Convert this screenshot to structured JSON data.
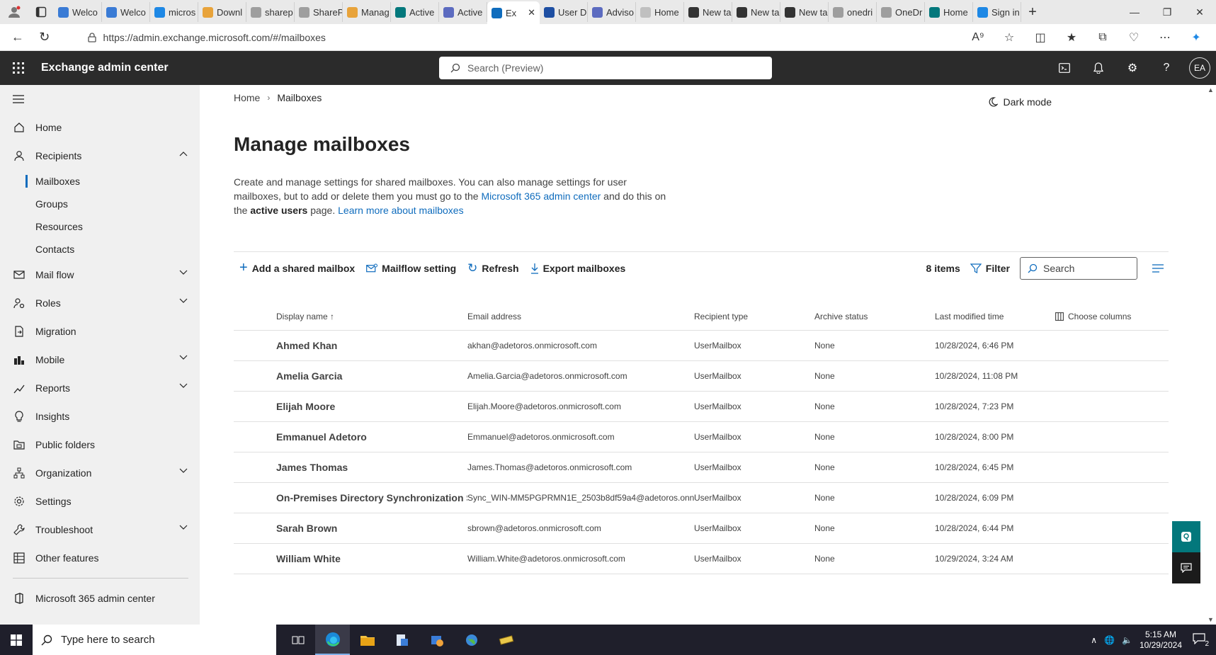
{
  "browser": {
    "tabs": [
      {
        "label": "Welco",
        "color": "#3a7bd5"
      },
      {
        "label": "Welco",
        "color": "#3a7bd5"
      },
      {
        "label": "micros",
        "color": "#1e88e5"
      },
      {
        "label": "Downl",
        "color": "#e8a33a"
      },
      {
        "label": "sharep",
        "color": "#9e9e9e"
      },
      {
        "label": "ShareP",
        "color": "#9e9e9e"
      },
      {
        "label": "Manag",
        "color": "#e8a33a"
      },
      {
        "label": "Active",
        "color": "#03787c"
      },
      {
        "label": "Active",
        "color": "#5c6bc0"
      },
      {
        "label": "Ex",
        "color": "#0f6cbd",
        "active": true
      },
      {
        "label": "User D",
        "color": "#1e4fa3"
      },
      {
        "label": "Adviso",
        "color": "#5c6bc0"
      },
      {
        "label": "Home",
        "color": "#c0c0c0"
      },
      {
        "label": "New ta",
        "color": "#333333"
      },
      {
        "label": "New ta",
        "color": "#333333"
      },
      {
        "label": "New ta",
        "color": "#333333"
      },
      {
        "label": "onedri",
        "color": "#9e9e9e"
      },
      {
        "label": "OneDr",
        "color": "#9e9e9e"
      },
      {
        "label": "Home",
        "color": "#03787c"
      },
      {
        "label": "Sign in",
        "color": "#1e88e5"
      }
    ],
    "url": "https://admin.exchange.microsoft.com/#/mailboxes"
  },
  "header": {
    "app_name": "Exchange admin center",
    "search_placeholder": "Search (Preview)",
    "avatar_initials": "EA"
  },
  "sidebar": {
    "items": [
      {
        "label": "Home",
        "icon": "home-icon",
        "expandable": false
      },
      {
        "label": "Recipients",
        "icon": "person-icon",
        "expandable": true,
        "expanded": true,
        "children": [
          {
            "label": "Mailboxes",
            "selected": true
          },
          {
            "label": "Groups"
          },
          {
            "label": "Resources"
          },
          {
            "label": "Contacts"
          }
        ]
      },
      {
        "label": "Mail flow",
        "icon": "mail-icon",
        "expandable": true
      },
      {
        "label": "Roles",
        "icon": "roles-icon",
        "expandable": true
      },
      {
        "label": "Migration",
        "icon": "migration-icon",
        "expandable": false
      },
      {
        "label": "Mobile",
        "icon": "mobile-icon",
        "expandable": true
      },
      {
        "label": "Reports",
        "icon": "reports-icon",
        "expandable": true
      },
      {
        "label": "Insights",
        "icon": "lightbulb-icon",
        "expandable": false
      },
      {
        "label": "Public folders",
        "icon": "folder-icon",
        "expandable": false
      },
      {
        "label": "Organization",
        "icon": "organization-icon",
        "expandable": true
      },
      {
        "label": "Settings",
        "icon": "gear-icon",
        "expandable": false
      },
      {
        "label": "Troubleshoot",
        "icon": "wrench-icon",
        "expandable": true
      },
      {
        "label": "Other features",
        "icon": "grid-icon",
        "expandable": false
      }
    ],
    "footer_link": "Microsoft 365 admin center"
  },
  "main": {
    "breadcrumb": [
      "Home",
      "Mailboxes"
    ],
    "dark_mode_label": "Dark mode",
    "title": "Manage mailboxes",
    "description": {
      "part1": "Create and manage settings for shared mailboxes. You can also manage settings for user mailboxes, but to add or delete them you must go to the ",
      "link1": "Microsoft 365 admin center",
      "part2": " and do this on the ",
      "bold": "active users",
      "part3": " page. ",
      "link2": "Learn more about mailboxes"
    },
    "commands": {
      "add": "Add a shared mailbox",
      "mailflow": "Mailflow setting",
      "refresh": "Refresh",
      "export": "Export mailboxes"
    },
    "item_count": "8 items",
    "filter_label": "Filter",
    "search_placeholder": "Search",
    "columns": {
      "display_name": "Display name",
      "email": "Email address",
      "recipient_type": "Recipient type",
      "archive_status": "Archive status",
      "last_modified": "Last modified time",
      "choose_columns": "Choose columns"
    },
    "rows": [
      {
        "name": "Ahmed Khan",
        "email": "akhan@adetoros.onmicrosoft.com",
        "type": "UserMailbox",
        "archive": "None",
        "modified": "10/28/2024, 6:46 PM"
      },
      {
        "name": "Amelia Garcia",
        "email": "Amelia.Garcia@adetoros.onmicrosoft.com",
        "type": "UserMailbox",
        "archive": "None",
        "modified": "10/28/2024, 11:08 PM"
      },
      {
        "name": "Elijah Moore",
        "email": "Elijah.Moore@adetoros.onmicrosoft.com",
        "type": "UserMailbox",
        "archive": "None",
        "modified": "10/28/2024, 7:23 PM"
      },
      {
        "name": "Emmanuel Adetoro",
        "email": "Emmanuel@adetoros.onmicrosoft.com",
        "type": "UserMailbox",
        "archive": "None",
        "modified": "10/28/2024, 8:00 PM"
      },
      {
        "name": "James Thomas",
        "email": "James.Thomas@adetoros.onmicrosoft.com",
        "type": "UserMailbox",
        "archive": "None",
        "modified": "10/28/2024, 6:45 PM"
      },
      {
        "name": "On-Premises Directory Synchronization S",
        "email": "Sync_WIN-MM5PGPRMN1E_2503b8df59a4@adetoros.onn",
        "type": "UserMailbox",
        "archive": "None",
        "modified": "10/28/2024, 6:09 PM"
      },
      {
        "name": "Sarah Brown",
        "email": "sbrown@adetoros.onmicrosoft.com",
        "type": "UserMailbox",
        "archive": "None",
        "modified": "10/28/2024, 6:44 PM"
      },
      {
        "name": "William White",
        "email": "William.White@adetoros.onmicrosoft.com",
        "type": "UserMailbox",
        "archive": "None",
        "modified": "10/29/2024, 3:24 AM"
      }
    ]
  },
  "taskbar": {
    "search_placeholder": "Type here to search",
    "time": "5:15 AM",
    "date": "10/29/2024",
    "notification_count": "2"
  },
  "colors": {
    "accent": "#0f6cbd",
    "header_bg": "#2b2b2b",
    "sidebar_bg": "#f0f0f0"
  }
}
